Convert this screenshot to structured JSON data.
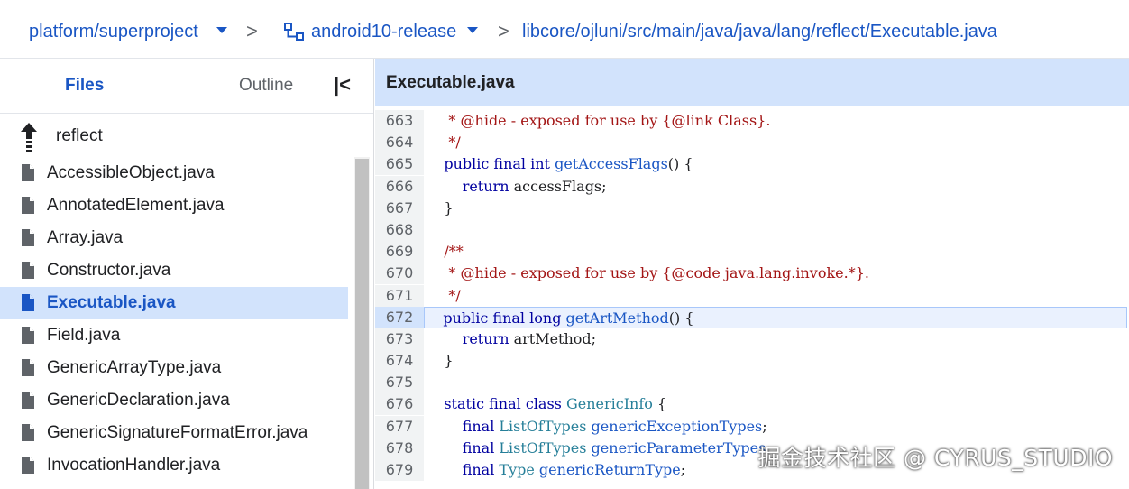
{
  "breadcrumb": {
    "project": "platform/superproject",
    "branch": "android10-release",
    "path": "libcore/ojluni/src/main/java/java/lang/reflect/Executable.java",
    "separator": ">"
  },
  "sidebar": {
    "tabs": {
      "files": "Files",
      "outline": "Outline"
    },
    "collapse_icon": "collapse-panel-icon",
    "up_dir": "reflect",
    "files": [
      "AccessibleObject.java",
      "AnnotatedElement.java",
      "Array.java",
      "Constructor.java",
      "Executable.java",
      "Field.java",
      "GenericArrayType.java",
      "GenericDeclaration.java",
      "GenericSignatureFormatError.java",
      "InvocationHandler.java"
    ],
    "active_file": "Executable.java"
  },
  "editor": {
    "title": "Executable.java",
    "highlighted_line": 672,
    "lines": [
      {
        "n": "663",
        "segs": [
          [
            "cm",
            "     * @hide - exposed for use by {@link Class}."
          ]
        ]
      },
      {
        "n": "664",
        "segs": [
          [
            "cm",
            "     */"
          ]
        ]
      },
      {
        "n": "665",
        "segs": [
          [
            "pl",
            "    "
          ],
          [
            "kw",
            "public final int "
          ],
          [
            "fn",
            "getAccessFlags"
          ],
          [
            "pl",
            "() {"
          ]
        ]
      },
      {
        "n": "666",
        "segs": [
          [
            "pl",
            "        "
          ],
          [
            "kw",
            "return "
          ],
          [
            "pl",
            "accessFlags;"
          ]
        ]
      },
      {
        "n": "667",
        "segs": [
          [
            "pl",
            "    }"
          ]
        ]
      },
      {
        "n": "668",
        "segs": [
          [
            "pl",
            ""
          ]
        ]
      },
      {
        "n": "669",
        "segs": [
          [
            "cm",
            "    /**"
          ]
        ]
      },
      {
        "n": "670",
        "segs": [
          [
            "cm",
            "     * @hide - exposed for use by {@code java.lang.invoke.*}."
          ]
        ]
      },
      {
        "n": "671",
        "segs": [
          [
            "cm",
            "     */"
          ]
        ]
      },
      {
        "n": "672",
        "segs": [
          [
            "pl",
            "    "
          ],
          [
            "kw",
            "public final long "
          ],
          [
            "fn",
            "getArtMethod"
          ],
          [
            "pl",
            "() {"
          ]
        ]
      },
      {
        "n": "673",
        "segs": [
          [
            "pl",
            "        "
          ],
          [
            "kw",
            "return "
          ],
          [
            "pl",
            "artMethod;"
          ]
        ]
      },
      {
        "n": "674",
        "segs": [
          [
            "pl",
            "    }"
          ]
        ]
      },
      {
        "n": "675",
        "segs": [
          [
            "pl",
            ""
          ]
        ]
      },
      {
        "n": "676",
        "segs": [
          [
            "pl",
            "    "
          ],
          [
            "kw",
            "static final class "
          ],
          [
            "ty",
            "GenericInfo"
          ],
          [
            "pl",
            " {"
          ]
        ]
      },
      {
        "n": "677",
        "segs": [
          [
            "pl",
            "        "
          ],
          [
            "kw",
            "final "
          ],
          [
            "ty",
            "ListOfTypes "
          ],
          [
            "fn",
            "genericExceptionTypes"
          ],
          [
            "pl",
            ";"
          ]
        ]
      },
      {
        "n": "678",
        "segs": [
          [
            "pl",
            "        "
          ],
          [
            "kw",
            "final "
          ],
          [
            "ty",
            "ListOfTypes "
          ],
          [
            "fn",
            "genericParameterTypes"
          ],
          [
            "pl",
            ";"
          ]
        ]
      },
      {
        "n": "679",
        "segs": [
          [
            "pl",
            "        "
          ],
          [
            "kw",
            "final "
          ],
          [
            "ty",
            "Type "
          ],
          [
            "fn",
            "genericReturnType"
          ],
          [
            "pl",
            ";"
          ]
        ]
      }
    ]
  },
  "watermark": "掘金技术社区 @ CYRUS_STUDIO",
  "colors": {
    "accent": "#1a56c4",
    "active_bg": "#d2e3fc",
    "comment": "#a31515",
    "keyword": "#0000a0",
    "type": "#267f99"
  }
}
